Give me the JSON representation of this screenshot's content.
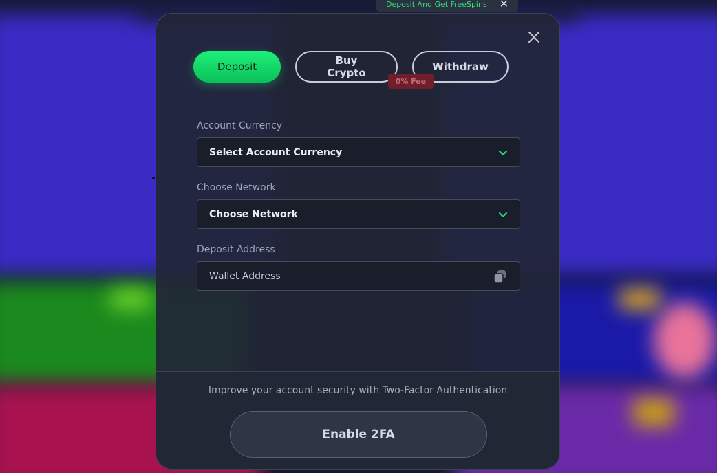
{
  "promo": {
    "text": "Deposit And Get FreeSpins",
    "close_icon": "close-icon"
  },
  "modal": {
    "tabs": [
      {
        "label": "Deposit",
        "active": true
      },
      {
        "label": "Buy Crypto",
        "active": false,
        "badge": "0% Fee"
      },
      {
        "label": "Withdraw",
        "active": false
      }
    ],
    "fields": {
      "account_currency": {
        "label": "Account Currency",
        "value": "Select Account Currency"
      },
      "network": {
        "label": "Choose Network",
        "value": "Choose Network"
      },
      "deposit_address": {
        "label": "Deposit Address",
        "placeholder": "Wallet Address"
      }
    },
    "security_text": "Improve your account security with Two-Factor Authentication",
    "enable_2fa_label": "Enable 2FA"
  },
  "colors": {
    "accent_green": "#1ef07a",
    "fee_badge": "#6e1f2b",
    "modal_bg": "#212636"
  }
}
